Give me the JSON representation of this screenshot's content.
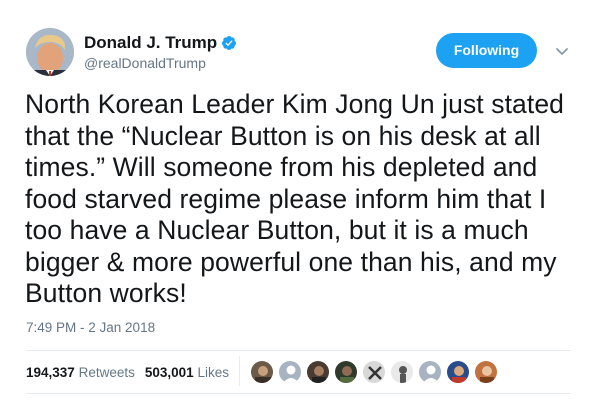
{
  "user": {
    "name": "Donald J. Trump",
    "handle": "@realDonaldTrump"
  },
  "follow_button": {
    "label": "Following"
  },
  "tweet": {
    "text": "North Korean Leader Kim Jong Un just stated\nthat the “Nuclear Button is on his desk at all\ntimes.” Will someone from his depleted and\nfood starved regime please inform him that I\ntoo have a Nuclear Button, but it is a much\nbigger & more powerful one than his, and my\nButton works!",
    "timestamp": "7:49 PM - 2 Jan 2018"
  },
  "stats": {
    "retweets_count": "194,337",
    "retweets_label": "Retweets",
    "likes_count": "503,001",
    "likes_label": "Likes"
  },
  "colors": {
    "accent": "#1da1f2",
    "text": "#14171a",
    "secondary": "#657786",
    "divider": "#e6ecf0"
  },
  "icons": {
    "verified": "verified-badge-icon",
    "caret": "chevron-down-icon"
  }
}
